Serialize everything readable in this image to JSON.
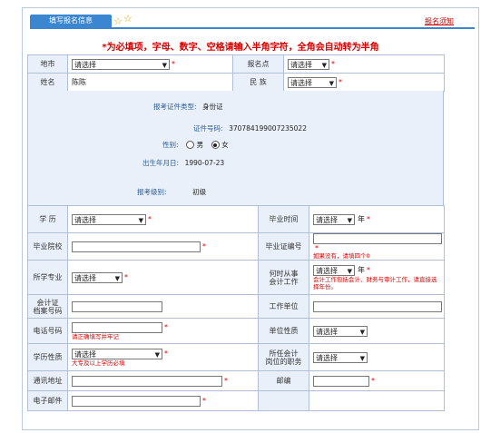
{
  "header": {
    "tab_label": "填写报名信息",
    "right_link": "报名须知",
    "notice": "*为必填项，字母、数字、空格请输入半角字符，全角会自动转为半角"
  },
  "rows_top": {
    "city_label": "地市",
    "city_value": "请选择",
    "site_label": "报名点",
    "site_value": "请选择",
    "name_label": "姓名",
    "name_value": "陈陈",
    "ethnic_label": "民 族",
    "ethnic_value": "请选择",
    "required_mark": "*"
  },
  "mid": {
    "id_type_label": "报考证件类型:",
    "id_type_value": "身份证",
    "id_no_label": "证件号码:",
    "id_no_value": "370784199007235022",
    "gender_label": "性别:",
    "gender_male": "男",
    "gender_female": "女",
    "birth_label": "出生年月日:",
    "birth_value": "1990-07-23",
    "level_label": "报考级别:",
    "level_value": "初级"
  },
  "rows_bottom": {
    "edu_label": "学 历",
    "edu_value": "请选择",
    "grad_time_label": "毕业时间",
    "grad_time_value": "请选择",
    "year_unit": "年",
    "school_label": "毕业院校",
    "cert_label": "毕业证编号",
    "cert_hint": "如果没有，请填四个0",
    "major_label": "所学专业",
    "major_value": "请选择",
    "work_since_label_1": "何时从事",
    "work_since_label_2": "会计工作",
    "work_since_value": "请选择",
    "work_since_hint": "会计工作包括会计、财务与审计工作，请直接选择年份。",
    "acct_no_label_1": "会计证",
    "acct_no_label_2": "档案号码",
    "employer_label": "工作单位",
    "phone_label": "电话号码",
    "phone_hint": "请正确填写并牢记",
    "unit_type_label": "单位性质",
    "unit_type_value": "请选择",
    "edu_type_label": "学历性质",
    "edu_type_value": "请选择",
    "edu_type_hint": "大专及以上学历必填",
    "position_label_1": "所任会计",
    "position_label_2": "岗位的职务",
    "position_value": "请选择",
    "address_label": "通讯地址",
    "postcode_label": "邮编",
    "email_label": "电子邮件"
  }
}
